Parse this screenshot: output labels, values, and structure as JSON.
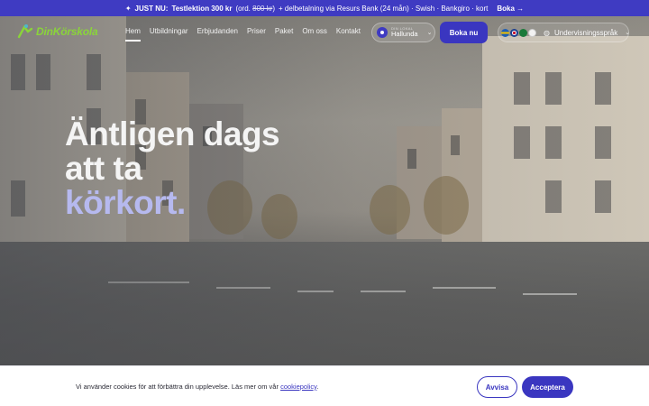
{
  "announcement": {
    "icon": "sparkle-icon",
    "prefix": "JUST NU:",
    "offer": "Testlektion 300 kr",
    "ord_open": "(ord.",
    "ord_price": "800 kr",
    "ord_close": ")",
    "rest": "+ delbetalning via Resurs Bank (24 mån) · Swish · Bankgiro · kort",
    "cta": "Boka →"
  },
  "logo": {
    "text": "DinKörskola"
  },
  "nav": {
    "items": [
      {
        "label": "Hem",
        "active": true
      },
      {
        "label": "Utbildningar"
      },
      {
        "label": "Erbjudanden"
      },
      {
        "label": "Priser"
      },
      {
        "label": "Paket"
      },
      {
        "label": "Om oss"
      },
      {
        "label": "Kontakt"
      }
    ]
  },
  "location": {
    "caption": "DIN LOKAL",
    "name": "Hallunda"
  },
  "header": {
    "book_label": "Boka nu"
  },
  "language": {
    "label": "Undervisningsspråk"
  },
  "hero": {
    "line1": "Äntligen dags",
    "line2": "att ta",
    "accent": "körkort."
  },
  "cookie": {
    "text": "Vi använder cookies för att förbättra din upplevelse. Läs mer om vår",
    "link": "cookiepolicy",
    "tail": ".",
    "decline": "Avvisa",
    "accept": "Acceptera"
  },
  "colors": {
    "brand": "#3a36c0",
    "logo_green": "#8ad43a",
    "accent_text": "#b6b9ef"
  }
}
